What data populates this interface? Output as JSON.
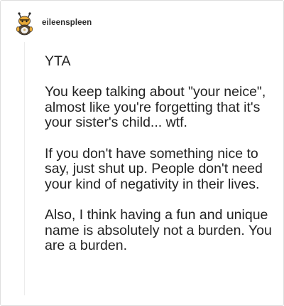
{
  "post": {
    "username": "eileenspleen",
    "avatar": {
      "icon": "cartoon-bee-animal-avatar"
    },
    "paragraphs": [
      "YTA",
      "You keep talking about \"your neice\", almost like you're forgetting that it's your sister's child... wtf.",
      "If you don't have something nice to say, just shut up. People don't need your kind of negativity in their lives.",
      "Also, I think having a fun and unique name is absolutely not a burden. You are a burden."
    ]
  },
  "colors": {
    "text": "#222222",
    "border": "#dedede",
    "thread_line": "#ececec"
  }
}
